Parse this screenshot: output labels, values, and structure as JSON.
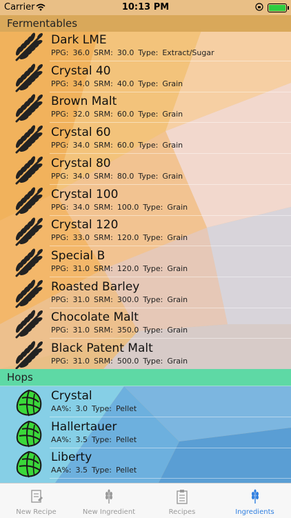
{
  "status": {
    "carrier": "Carrier",
    "time": "10:13 PM"
  },
  "colors": {
    "fermentables_header": "#d9a85a",
    "hops_header": "#5ed9a5",
    "hop_green": "#3ad83a",
    "active_tab": "#2f7fe0"
  },
  "sections": {
    "fermentables_title": "Fermentables",
    "hops_title": "Hops"
  },
  "fermentables": [
    {
      "name": "Dark LME",
      "ppg_label": "PPG:",
      "ppg": "36.0",
      "srm_label": "SRM:",
      "srm": "30.0",
      "type_label": "Type:",
      "type": "Extract/Sugar"
    },
    {
      "name": "Crystal 40",
      "ppg_label": "PPG:",
      "ppg": "34.0",
      "srm_label": "SRM:",
      "srm": "40.0",
      "type_label": "Type:",
      "type": "Grain"
    },
    {
      "name": "Brown Malt",
      "ppg_label": "PPG:",
      "ppg": "32.0",
      "srm_label": "SRM:",
      "srm": "60.0",
      "type_label": "Type:",
      "type": "Grain"
    },
    {
      "name": "Crystal 60",
      "ppg_label": "PPG:",
      "ppg": "34.0",
      "srm_label": "SRM:",
      "srm": "60.0",
      "type_label": "Type:",
      "type": "Grain"
    },
    {
      "name": "Crystal 80",
      "ppg_label": "PPG:",
      "ppg": "34.0",
      "srm_label": "SRM:",
      "srm": "80.0",
      "type_label": "Type:",
      "type": "Grain"
    },
    {
      "name": "Crystal 100",
      "ppg_label": "PPG:",
      "ppg": "34.0",
      "srm_label": "SRM:",
      "srm": "100.0",
      "type_label": "Type:",
      "type": "Grain"
    },
    {
      "name": "Crystal 120",
      "ppg_label": "PPG:",
      "ppg": "33.0",
      "srm_label": "SRM:",
      "srm": "120.0",
      "type_label": "Type:",
      "type": "Grain"
    },
    {
      "name": "Special B",
      "ppg_label": "PPG:",
      "ppg": "31.0",
      "srm_label": "SRM:",
      "srm": "120.0",
      "type_label": "Type:",
      "type": "Grain"
    },
    {
      "name": "Roasted Barley",
      "ppg_label": "PPG:",
      "ppg": "31.0",
      "srm_label": "SRM:",
      "srm": "300.0",
      "type_label": "Type:",
      "type": "Grain"
    },
    {
      "name": "Chocolate Malt",
      "ppg_label": "PPG:",
      "ppg": "31.0",
      "srm_label": "SRM:",
      "srm": "350.0",
      "type_label": "Type:",
      "type": "Grain"
    },
    {
      "name": "Black Patent Malt",
      "ppg_label": "PPG:",
      "ppg": "31.0",
      "srm_label": "SRM:",
      "srm": "500.0",
      "type_label": "Type:",
      "type": "Grain"
    }
  ],
  "hops": [
    {
      "name": "Crystal",
      "aa_label": "AA%:",
      "aa": "3.0",
      "type_label": "Type:",
      "type": "Pellet"
    },
    {
      "name": "Hallertauer",
      "aa_label": "AA%:",
      "aa": "3.5",
      "type_label": "Type:",
      "type": "Pellet"
    },
    {
      "name": "Liberty",
      "aa_label": "AA%:",
      "aa": "3.5",
      "type_label": "Type:",
      "type": "Pellet"
    }
  ],
  "icons": {
    "fermentable": "wheat-icon",
    "hop": "hop-cone-icon"
  },
  "tabbar": {
    "tabs": [
      {
        "label": "New Recipe",
        "icon": "new-recipe-icon"
      },
      {
        "label": "New Ingredient",
        "icon": "wheat-icon"
      },
      {
        "label": "Recipes",
        "icon": "clipboard-icon"
      },
      {
        "label": "Ingredients",
        "icon": "wheat-icon"
      }
    ],
    "active_index": 3
  }
}
